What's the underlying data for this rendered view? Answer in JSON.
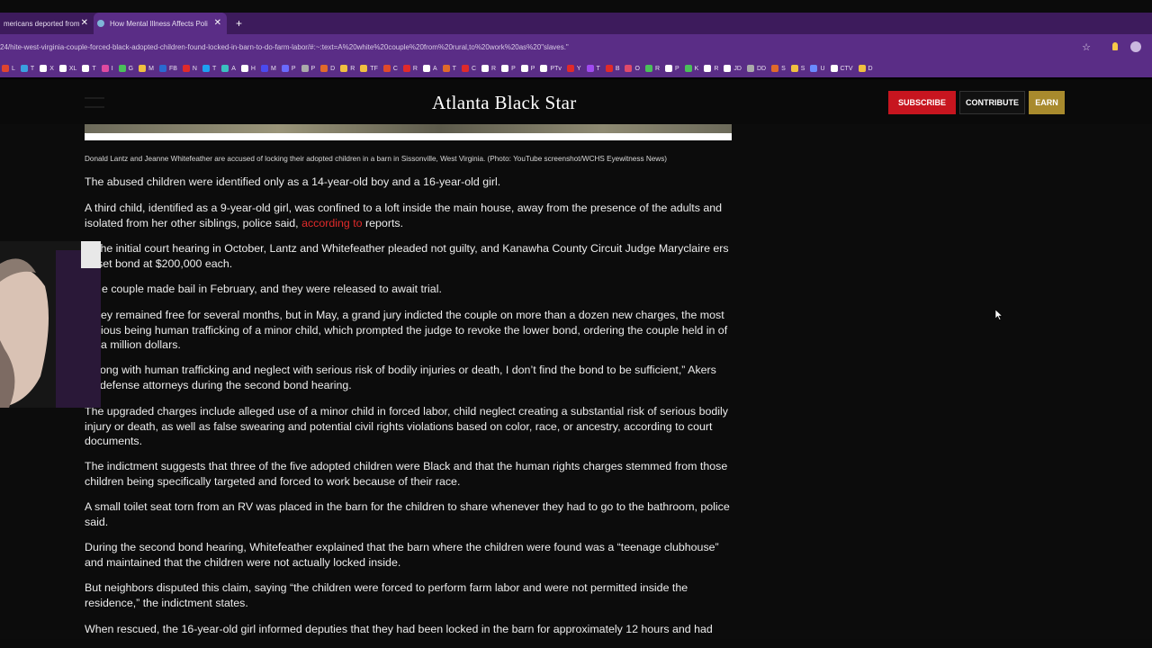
{
  "browser": {
    "tabs": [
      {
        "label": "mericans deported from"
      },
      {
        "label": "How Mental Illness Affects Poli"
      }
    ],
    "url": "24/hite-west-virginia-couple-forced-black-adopted-children-found-locked-in-barn-to-do-farm-labor/#:~:text=A%20white%20couple%20from%20rural,to%20work%20as%20\"slaves.\"",
    "bookmarks": [
      "L",
      "T",
      "X",
      "XL",
      "T",
      "I",
      "G",
      "M",
      "FB",
      "N",
      "T",
      "A",
      "H",
      "M",
      "P",
      "P",
      "D",
      "R",
      "TF",
      "C",
      "R",
      "A",
      "T",
      "C",
      "R",
      "P",
      "P",
      "PTv",
      "Y",
      "T",
      "B",
      "O",
      "R",
      "P",
      "K",
      "R",
      "JD",
      "DD",
      "S",
      "S",
      "U",
      "CTV",
      "D"
    ]
  },
  "site": {
    "logo": "Atlanta Black Star",
    "subscribe": "SUBSCRIBE",
    "contribute": "CONTRIBUTE",
    "earn": "EARN"
  },
  "article": {
    "caption": "Donald Lantz and Jeanne Whitefeather are accused of locking their adopted children in a barn in Sissonville, West Virginia. (Photo: YouTube screenshot/WCHS Eyewitness News)",
    "p1": "The abused children were identified only as a 14-year-old boy and a 16-year-old girl.",
    "p2_before": "A third child, identified as a 9-year-old girl, was confined to a loft inside the main house, away from the presence of the adults and isolated from her other siblings, police said, ",
    "p2_link": "according to",
    "p2_after": " reports.",
    "p3": "the initial court hearing in October, Lantz and Whitefeather pleaded not guilty, and Kanawha County Circuit Judge Maryclaire ers set bond at $200,000 each.",
    "p4": "e couple made bail in February, and they were released to await trial.",
    "p5": "ey remained free for several months, but in May, a grand jury indicted the couple on more than a dozen new charges, the most ious being human trafficking of a minor child, which prompted the judge to revoke the lower bond, ordering the couple held in of a million dollars.",
    "p6": "ong with human trafficking and neglect with serious risk of bodily injuries or death, I don’t find the bond to be sufficient,” Akers defense attorneys during the second bond hearing.",
    "p7": "The upgraded charges include alleged use of a minor child in forced labor, child neglect creating a substantial risk of serious bodily injury or death, as well as false swearing and potential civil rights violations based on color, race, or ancestry, according to court documents.",
    "p8": "The indictment suggests that three of the five adopted children were Black and that the human rights charges stemmed from those children being specifically targeted and forced to work because of their race.",
    "p9": "A small toilet seat torn from an RV was placed in the barn for the children to share whenever they had to go to the bathroom, police said.",
    "p10": "During the second bond hearing, Whitefeather explained that the barn where the children were found was a “teenage clubhouse” and maintained that the children were not actually locked inside.",
    "p11": "But neighbors disputed this claim, saying “the children were forced to perform farm labor and were not permitted inside the residence,” the indictment states.",
    "p12": "When rescued, the 16-year-old girl informed deputies that they had been locked in the barn for approximately 12 hours and had"
  }
}
